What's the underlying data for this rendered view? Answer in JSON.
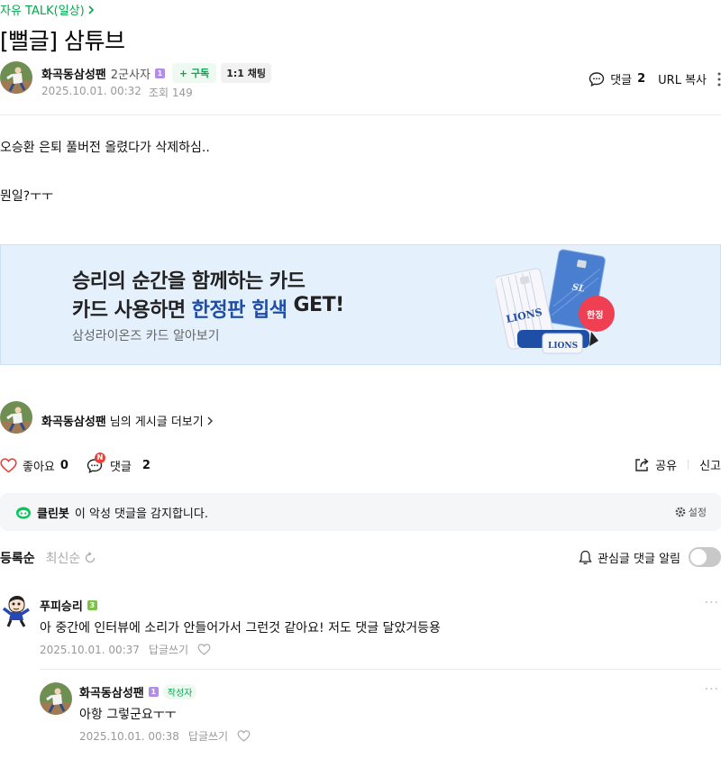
{
  "category": {
    "label": "자유 TALK(일상)",
    "chevron": "chevron-right-icon"
  },
  "post": {
    "title": "[뻘글] 삼튜브",
    "author": {
      "name": "화곡동삼성팬",
      "rank": "2군사자",
      "level_badge": "1",
      "subscribe_label": "+ 구독",
      "chat_label": "1:1 채팅"
    },
    "date": "2025.10.01. 00:32",
    "views_label": "조회 149",
    "tools": {
      "comment_label": "댓글",
      "comment_count": "2",
      "url_copy": "URL 복사",
      "more_icon": "kebab-icon"
    },
    "body_lines": [
      "오승환 은퇴 풀버전 올렸다가 삭제하심..",
      "뭔일?ㅜㅜ"
    ]
  },
  "ad": {
    "line1": "승리의 순간을 함께하는 카드",
    "line2_pre": "카드 사용하면",
    "line2_hl": "한정판 힙색",
    "line2_post": "GET!",
    "sub": "삼성라이온즈 카드 알아보기",
    "card_text": "LIONS",
    "card2_text": "SL",
    "limited_badge": "한정",
    "bag_text": "LIONS",
    "bg_color": "#e5f0fd"
  },
  "more_posts": {
    "name": "화곡동삼성팬",
    "suffix": "님의 게시글 더보기"
  },
  "reactions": {
    "like_label": "좋아요",
    "like_count": "0",
    "comment_label": "댓글",
    "comment_count": "2",
    "new_badge": "N",
    "share_label": "공유",
    "report_label": "신고"
  },
  "cleanbot": {
    "name": "클린봇",
    "message": "이 악성 댓글을 감지합니다.",
    "setting_label": "설정"
  },
  "sort": {
    "active": "등록순",
    "inactive": "최신순"
  },
  "notify": {
    "label": "관심글 댓글 알림",
    "enabled": false
  },
  "comments": [
    {
      "author": "푸피승리",
      "level_badge": "3",
      "text": "아 중간에 인터뷰에 소리가 안들어가서 그런것 같아요! 저도 댓글 달았거등용",
      "date": "2025.10.01. 00:37",
      "reply_label": "답글쓰기",
      "more": "···"
    },
    {
      "author": "화곡동삼성팬",
      "level_badge": "1",
      "writer_badge": "작성자",
      "text": "아항 그렇군요ㅜㅜ",
      "date": "2025.10.01. 00:38",
      "reply_label": "답글쓰기",
      "more": "···"
    }
  ],
  "colors": {
    "accent_green": "#03a94d",
    "badge_purple": "#b18ce8",
    "like_red": "#e8423a"
  }
}
